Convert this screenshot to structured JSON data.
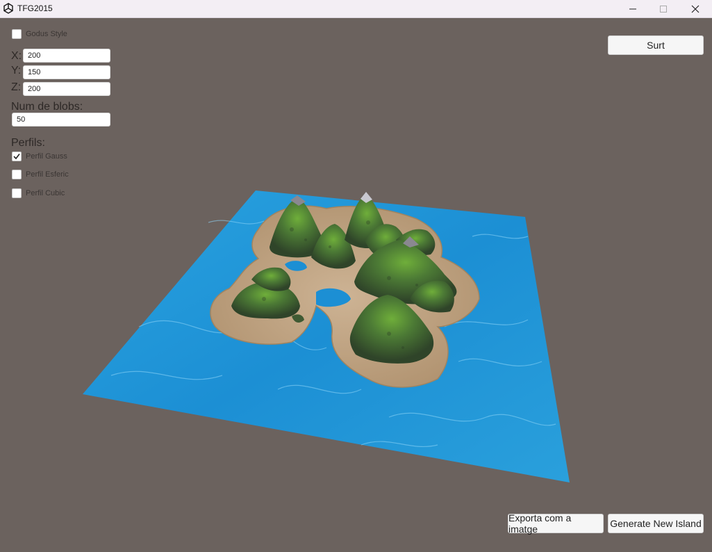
{
  "window": {
    "title": "TFG2015"
  },
  "options": {
    "godus_style": {
      "label": "Godus Style",
      "checked": false
    }
  },
  "dimensions": {
    "x_label": "X:",
    "x_value": "200",
    "y_label": "Y:",
    "y_value": "150",
    "z_label": "Z:",
    "z_value": "200"
  },
  "blobs": {
    "label": "Num de blobs:",
    "value": "50"
  },
  "profiles": {
    "heading": "Perfils:",
    "items": [
      {
        "label": "Perfil Gauss",
        "checked": true
      },
      {
        "label": "Perfil Esferic",
        "checked": false
      },
      {
        "label": "Perfil Cubic",
        "checked": false
      }
    ]
  },
  "buttons": {
    "exit": "Surt",
    "export": "Exporta com a imatge",
    "generate": "Generate New Island"
  },
  "colors": {
    "background": "#6b625e",
    "water": "#1e8fd0",
    "sand": "#bfa285",
    "forest": "#3f5a33",
    "grass": "#6ea83a",
    "peak": "#8a8890"
  }
}
